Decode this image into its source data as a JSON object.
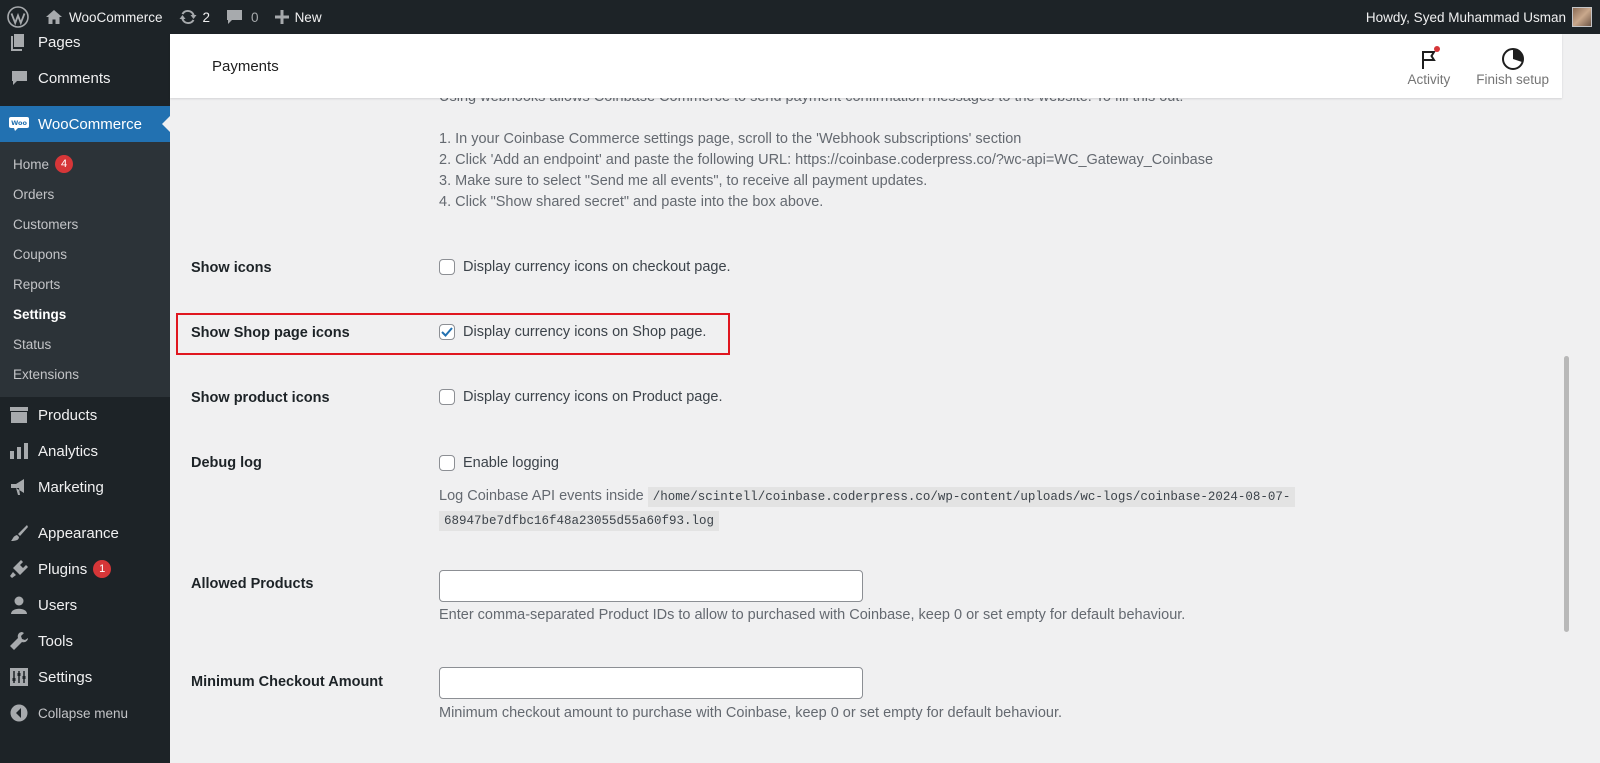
{
  "adminbar": {
    "site_name": "WooCommerce",
    "updates_count": "2",
    "comments_count": "0",
    "new_label": "New",
    "greeting": "Howdy, Syed Muhammad Usman"
  },
  "sidebar": {
    "top_items": [
      {
        "label": "Pages",
        "icon": "pages-icon"
      },
      {
        "label": "Comments",
        "icon": "comments-icon"
      }
    ],
    "woocommerce": {
      "label": "WooCommerce",
      "submenu": [
        {
          "label": "Home",
          "badge": "4"
        },
        {
          "label": "Orders"
        },
        {
          "label": "Customers"
        },
        {
          "label": "Coupons"
        },
        {
          "label": "Reports"
        },
        {
          "label": "Settings",
          "current": true
        },
        {
          "label": "Status"
        },
        {
          "label": "Extensions"
        }
      ]
    },
    "items": [
      {
        "label": "Products"
      },
      {
        "label": "Analytics"
      },
      {
        "label": "Marketing"
      },
      {
        "label": "Appearance"
      },
      {
        "label": "Plugins",
        "badge": "1"
      },
      {
        "label": "Users"
      },
      {
        "label": "Tools"
      },
      {
        "label": "Settings"
      }
    ],
    "collapse_label": "Collapse menu"
  },
  "header": {
    "title": "Payments",
    "activity_label": "Activity",
    "finish_setup_label": "Finish setup"
  },
  "webhook_help": {
    "cut_line": "Using webhooks allows Coinbase Commerce to send payment confirmation messages to the website. To fill this out:",
    "steps": [
      "1. In your Coinbase Commerce settings page, scroll to the 'Webhook subscriptions' section",
      "2. Click 'Add an endpoint' and paste the following URL: https://coinbase.coderpress.co/?wc-api=WC_Gateway_Coinbase",
      "3. Make sure to select \"Send me all events\", to receive all payment updates.",
      "4. Click \"Show shared secret\" and paste into the box above."
    ]
  },
  "settings": {
    "show_icons": {
      "label": "Show icons",
      "checkbox_label": "Display currency icons on checkout page.",
      "checked": false
    },
    "show_shop_icons": {
      "label": "Show Shop page icons",
      "checkbox_label": "Display currency icons on Shop page.",
      "checked": true
    },
    "show_product_icons": {
      "label": "Show product icons",
      "checkbox_label": "Display currency icons on Product page.",
      "checked": false
    },
    "debug_log": {
      "label": "Debug log",
      "checkbox_label": "Enable logging",
      "checked": false,
      "desc_prefix": "Log Coinbase API events inside",
      "path_line1": "/home/scintell/coinbase.coderpress.co/wp-content/uploads/wc-logs/coinbase-2024-08-07-",
      "path_line2": "68947be7dfbc16f48a23055d55a60f93.log"
    },
    "allowed_products": {
      "label": "Allowed Products",
      "value": "",
      "help": "Enter comma-separated Product IDs to allow to purchased with Coinbase, keep 0 or set empty for default behaviour."
    },
    "min_checkout": {
      "label": "Minimum Checkout Amount",
      "value": "",
      "help": "Minimum checkout amount to purchase with Coinbase, keep 0 or set empty for default behaviour."
    }
  },
  "colors": {
    "adminbar_bg": "#1d2327",
    "menu_current": "#2271b1",
    "highlight_border": "#e0161f",
    "badge": "#d63638",
    "checkbox_check": "#2271b1"
  }
}
